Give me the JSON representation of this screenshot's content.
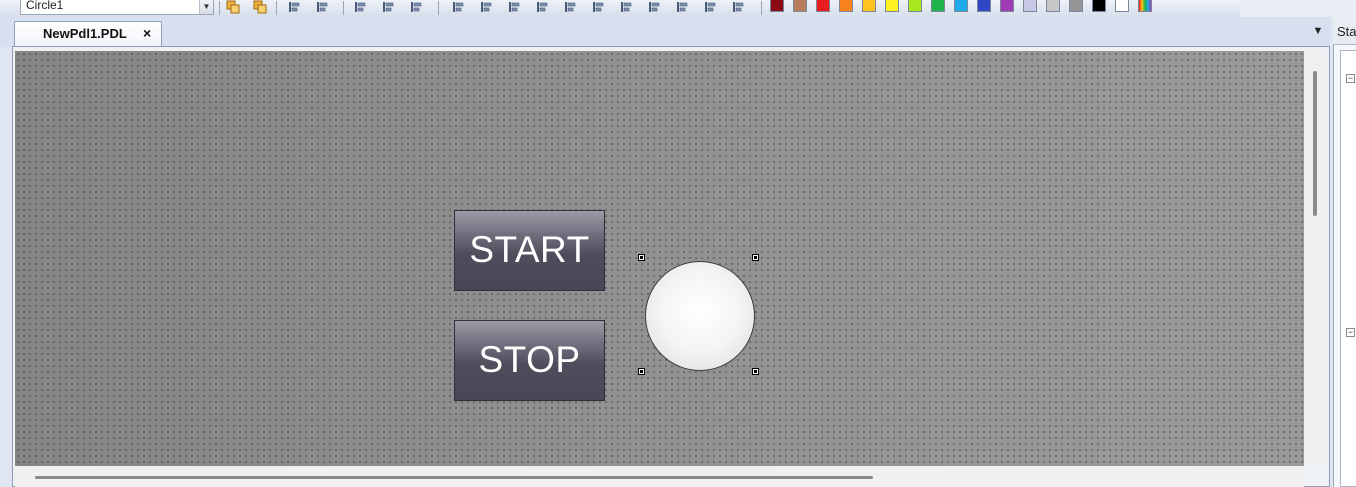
{
  "toolbar": {
    "object_selector": {
      "value": "Circle1"
    },
    "icons": [
      "bring-to-front-icon",
      "send-to-back-icon",
      "magic-wand-icon",
      "eyedropper-icon",
      "flip-vertical-icon",
      "flip-horizontal-icon",
      "rotate-icon",
      "align-left-icon",
      "align-right-icon",
      "align-top-icon",
      "align-bottom-icon",
      "center-horizontal-icon",
      "center-vertical-icon",
      "distribute-horizontal-icon",
      "distribute-vertical-icon",
      "same-width-icon",
      "same-height-icon",
      "same-size-icon"
    ],
    "palette": [
      "#8b0a14",
      "#b87d5c",
      "#e81e1e",
      "#f7821e",
      "#ffc21e",
      "#fff21e",
      "#a8e61e",
      "#1eb44b",
      "#1eaae6",
      "#3246c8",
      "#a03cb4",
      "#c8c8e6",
      "#c8c8c8",
      "#969696",
      "#000000",
      "#ffffff",
      "rainbow"
    ]
  },
  "tabs": [
    {
      "label": "NewPdl1.PDL",
      "close": "×"
    }
  ],
  "tab_menu_glyph": "▼",
  "canvas": {
    "buttons": [
      {
        "label": "START"
      },
      {
        "label": "STOP"
      }
    ],
    "selected_object": "Circle1"
  },
  "side_panel": {
    "title": "Sta",
    "toggles": [
      "−",
      "−"
    ]
  },
  "colors": {
    "canvas_bg": "#8e8e8e",
    "button_face": "#4d4d5b",
    "circle_fill": "#f4f4f4"
  }
}
